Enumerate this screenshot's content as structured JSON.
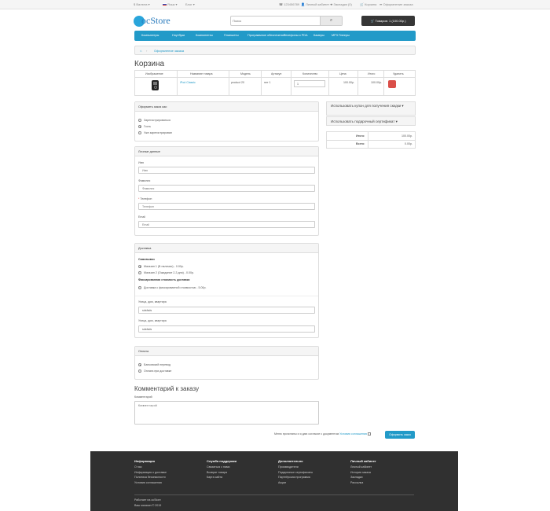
{
  "topbar": {
    "currency": "$ Валюта ▾",
    "language": "Язык ▾",
    "blog": "Блог ▾",
    "phone": "123456789",
    "account": "Личный кабинет ▾",
    "wishlist": "Закладки (0)",
    "cart": "Корзина",
    "checkout": "Оформление заказа"
  },
  "header": {
    "logo": "ocStore",
    "search_placeholder": "Поиск",
    "cart_button": "Товаров: 1 (100.00р.)"
  },
  "menu": [
    "Компьютеры",
    "Ноутбуки",
    "Компоненты",
    "Планшеты",
    "Программное обеспечение",
    "Телефоны и PDA",
    "Камеры",
    "MP3 Плееры"
  ],
  "breadcrumb": {
    "current": "Оформление заказа"
  },
  "page_title": "Корзина",
  "cart_table": {
    "headers": [
      "Изображение",
      "Название товара",
      "Модель",
      "Артикул",
      "Количество",
      "Цена",
      "Итого",
      "Удалить"
    ],
    "row": {
      "name": "iPod Classic",
      "model": "product 20",
      "sku": "нет 1",
      "qty": "1",
      "price": "100.00р.",
      "total": "100.00р."
    }
  },
  "checkout_options": {
    "title": "Оформить заказ как:",
    "options": [
      "Зарегистрироваться",
      "Гость",
      "Уже зарегистрирован"
    ],
    "selected": 1
  },
  "personal": {
    "title": "Личные данные",
    "fields": [
      {
        "label": "Имя",
        "placeholder": "Имя",
        "required": false
      },
      {
        "label": "Фамилия",
        "placeholder": "Фамилия",
        "required": false
      },
      {
        "label": "Телефон",
        "placeholder": "Телефон",
        "required": true
      },
      {
        "label": "Email",
        "placeholder": "Email",
        "required": false
      }
    ]
  },
  "delivery": {
    "title": "Доставка",
    "pickup_heading": "Самовывоз",
    "pickup_options": [
      "Магазин 1 (В наличии) - 0.00р.",
      "Магазин 2 (Ожидание 2-3 дня) - 0.00р."
    ],
    "fixed_heading": "Фиксированная стоимость доставки",
    "fixed_option": "Доставка с фиксированной стоимостью - 5.00р.",
    "address1_label": "Улица, дом, квартира",
    "address1_value": "sdsfsds",
    "address2_label": "Улица, дом, квартира",
    "address2_value": "sdsfsds"
  },
  "payment": {
    "title": "Оплата",
    "options": [
      "Банковский перевод",
      "Оплата при доставке"
    ]
  },
  "coupon": {
    "label": "Использовать купон для получения скидки ▾"
  },
  "voucher": {
    "label": "Использовать подарочный сертификат ▾"
  },
  "totals": [
    {
      "label": "Итого:",
      "value": "100.00р."
    },
    {
      "label": "Всего:",
      "value": "0.00р."
    }
  ],
  "comment": {
    "heading": "Комментарий к заказу",
    "label": "Комментарий",
    "placeholder": "Комментарий"
  },
  "agreement": {
    "text": "Меню прочитаны и я даю согласие с документом",
    "link": "Условия соглашения"
  },
  "checkout_button": "Оформить заказ",
  "footer": {
    "columns": [
      {
        "title": "Информация",
        "links": [
          "О нас",
          "Информация о доставке",
          "Политика безопасности",
          "Условия соглашения"
        ]
      },
      {
        "title": "Служба поддержки",
        "links": [
          "Связаться с нами",
          "Возврат товара",
          "Карта сайта"
        ]
      },
      {
        "title": "Дополнительно",
        "links": [
          "Производители",
          "Подарочные сертификаты",
          "Партнёрская программа",
          "Акции"
        ]
      },
      {
        "title": "Личный кабинет",
        "links": [
          "Личный кабинет",
          "История заказа",
          "Закладки",
          "Рассылка"
        ]
      }
    ],
    "powered": "Работает на ocStore",
    "copyright": "Ваш магазин © 2019"
  }
}
